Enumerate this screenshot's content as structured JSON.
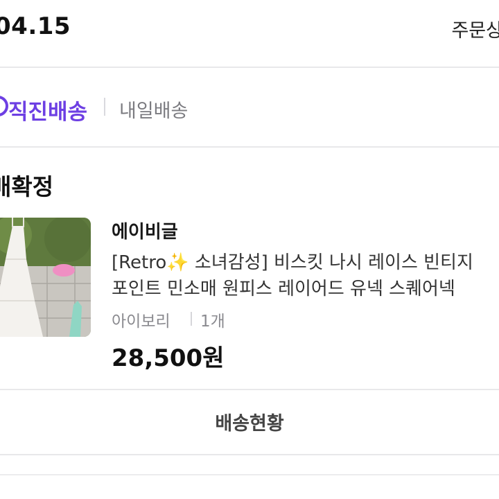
{
  "header": {
    "order_date": "04.15",
    "order_detail_link": "주문상"
  },
  "delivery": {
    "direct_delivery": "직진배송",
    "tomorrow_delivery": "내일배송",
    "accent_color": "#6d3fe3"
  },
  "order": {
    "status": "매확정",
    "product": {
      "seller": "에이비글",
      "title_line1": "[Retro✨ 소녀감성] 비스킷 나시 레이스 빈티지",
      "title_line2": "포인트 민소매 원피스 레이어드 유넥 스퀘어넥",
      "option_color": "아이보리",
      "option_qty": "1개",
      "price": "28,500원"
    }
  },
  "actions": {
    "delivery_status": "배송현황"
  }
}
